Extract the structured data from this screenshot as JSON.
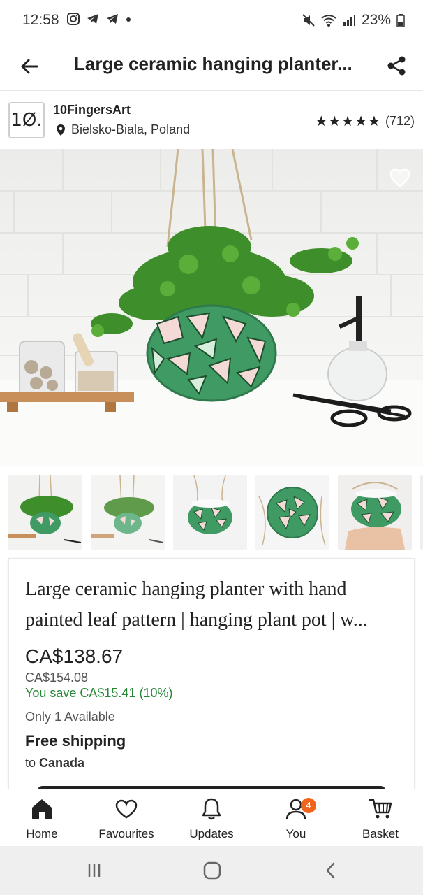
{
  "status_bar": {
    "time": "12:58",
    "battery_percent": "23%"
  },
  "app_bar": {
    "title": "Large ceramic hanging planter..."
  },
  "shop": {
    "logo_text": "1Ø.",
    "name": "10FingersArt",
    "location": "Bielsko-Biala, Poland",
    "rating_stars": 5,
    "review_count": "(712)"
  },
  "listing": {
    "title": "Large ceramic hanging planter with hand painted leaf pattern | hanging plant pot | w...",
    "price": "CA$138.67",
    "original_price": "CA$154.08",
    "savings": "You save CA$15.41 (10%)",
    "availability": "Only 1 Available",
    "shipping_title": "Free shipping",
    "shipping_to_prefix": "to",
    "shipping_to_country": "Canada"
  },
  "thumbnails": [
    {
      "icon": "planter-with-plant-thumb"
    },
    {
      "icon": "planter-with-plant-thumb-2"
    },
    {
      "icon": "empty-planter-thumb"
    },
    {
      "icon": "planter-top-view-thumb"
    },
    {
      "icon": "planter-in-hand-thumb"
    }
  ],
  "bottom_nav": {
    "items": [
      {
        "label": "Home",
        "icon": "home-icon",
        "active": true
      },
      {
        "label": "Favourites",
        "icon": "heart-icon"
      },
      {
        "label": "Updates",
        "icon": "bell-icon"
      },
      {
        "label": "You",
        "icon": "user-icon",
        "badge": "4"
      },
      {
        "label": "Basket",
        "icon": "basket-icon"
      }
    ]
  },
  "colors": {
    "accent_orange": "#f1641e",
    "savings_green": "#258635",
    "planter_green": "#3f9a63"
  }
}
